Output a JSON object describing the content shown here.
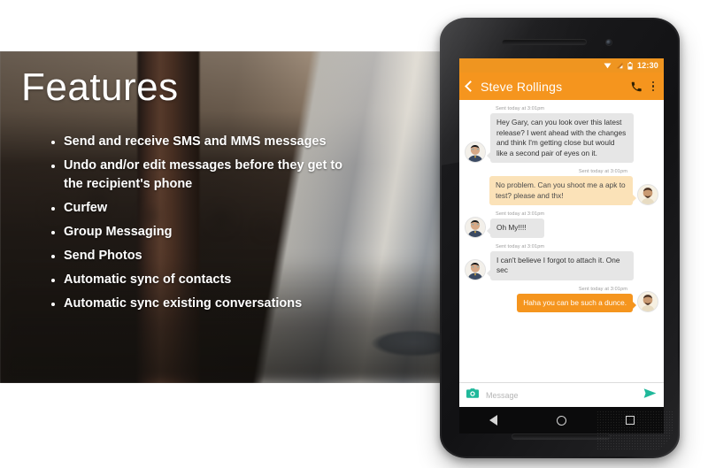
{
  "hero": {
    "title": "Features",
    "features": [
      "Send and receive SMS and MMS messages",
      "Undo and/or edit messages before they get to the recipient's phone",
      "Curfew",
      "Group Messaging",
      "Send Photos",
      "Automatic sync of contacts",
      "Automatic sync existing conversations"
    ]
  },
  "phone": {
    "statusbar": {
      "time": "12:30"
    },
    "appbar": {
      "title": "Steve Rollings"
    },
    "conversation": [
      {
        "direction": "in",
        "timestamp": "Sent today at 3:01pm",
        "text": "Hey Gary, can you look over this latest release? I went ahead with the changes and think I'm getting close but would like a second pair of eyes on it."
      },
      {
        "direction": "out",
        "style": "light",
        "timestamp": "Sent today at 3:01pm",
        "text": "No problem. Can you shoot me a apk to test? please and thx!"
      },
      {
        "direction": "in",
        "timestamp": "Sent today at 3:01pm",
        "text": "Oh My!!!!"
      },
      {
        "direction": "in",
        "timestamp": "Sent today at 3:01pm",
        "text": "I can't believe I forgot to attach it. One sec"
      },
      {
        "direction": "out",
        "style": "solid",
        "timestamp": "Sent today at 3:01pm",
        "text": "Haha you can be such a dunce."
      }
    ],
    "composer": {
      "placeholder": "Message",
      "value": ""
    }
  },
  "colors": {
    "accent_orange": "#f5951e",
    "statusbar_orange": "#ef9520",
    "bubble_in": "#e6e6e6",
    "bubble_out_light": "#fbe2b8",
    "bubble_out_solid": "#f5951e",
    "composer_teal": "#1fb89a"
  }
}
